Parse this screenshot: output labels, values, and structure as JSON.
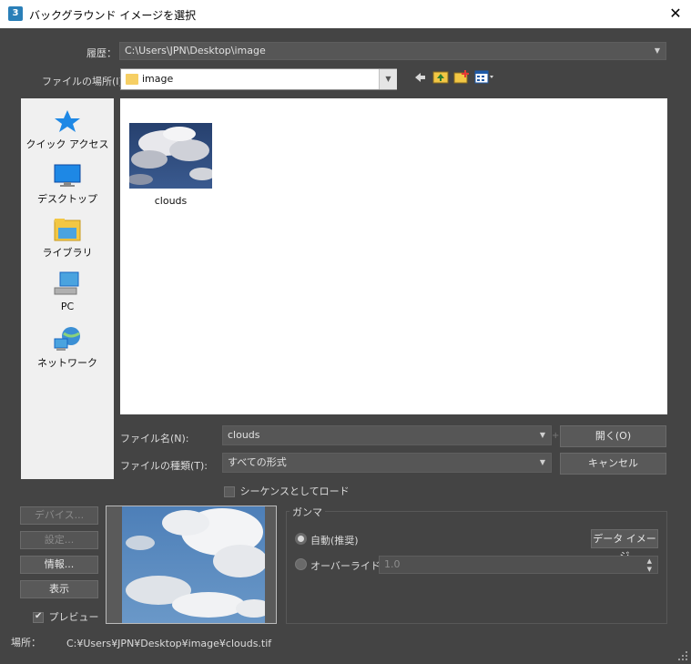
{
  "window": {
    "title": "バックグラウンド イメージを選択",
    "app_icon_text": "3",
    "close_label": "✕"
  },
  "history": {
    "label": "履歴：",
    "value": "C:\\Users\\JPN\\Desktop\\image"
  },
  "look_in": {
    "label": "ファイルの場所(I):",
    "value": "image"
  },
  "places": [
    {
      "label": "クイック アクセス",
      "icon": "star-icon"
    },
    {
      "label": "デスクトップ",
      "icon": "desktop-icon"
    },
    {
      "label": "ライブラリ",
      "icon": "library-folder-icon"
    },
    {
      "label": "PC",
      "icon": "computer-icon"
    },
    {
      "label": "ネットワーク",
      "icon": "network-icon"
    }
  ],
  "files": [
    {
      "name": "clouds"
    }
  ],
  "filename": {
    "label": "ファイル名(N):",
    "value": "clouds"
  },
  "filetype": {
    "label": "ファイルの種類(T):",
    "value": "すべての形式"
  },
  "buttons": {
    "open": "開く(O)",
    "cancel": "キャンセル",
    "devices": "デバイス...",
    "setup": "設定...",
    "info": "情報...",
    "view": "表示"
  },
  "sequence": {
    "label": "シーケンスとしてロード",
    "checked": false
  },
  "preview": {
    "label": "プレビュー",
    "checked": true
  },
  "gamma": {
    "title": "ガンマ",
    "auto_label": "自動(推奨)",
    "override_label": "オーバーライド:",
    "override_value": "1.0",
    "data_image_button": "データ イメージ",
    "selected": "auto"
  },
  "location": {
    "label": "場所：",
    "value": "C:¥Users¥JPN¥Desktop¥image¥clouds.tif"
  },
  "colors": {
    "background": "#444444",
    "field": "#565656",
    "panel": "#f0f0f0",
    "accent_blue": "#1e88e5"
  }
}
